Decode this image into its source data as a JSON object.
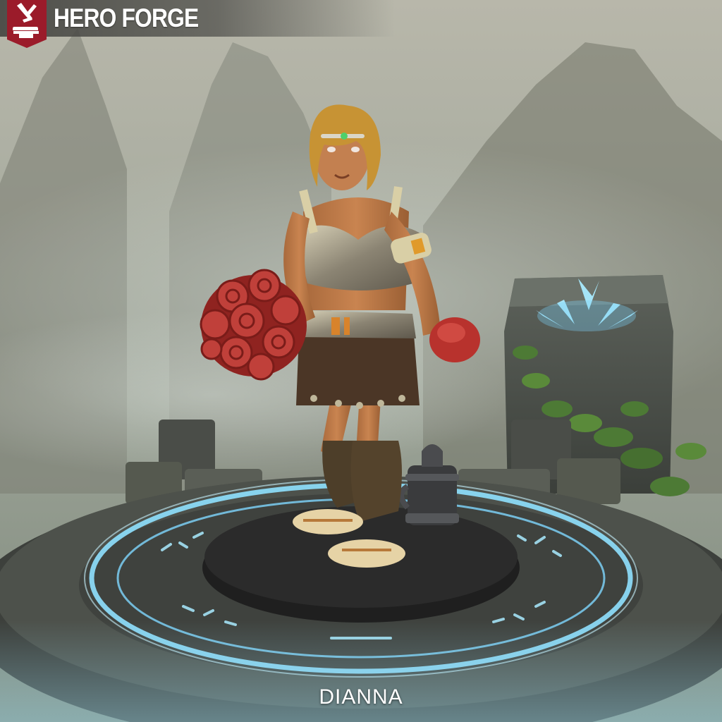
{
  "brand": {
    "title": "HERO FORGE",
    "logo_icon": "anvil-hammer-icon",
    "badge_color": "#9b1b2a"
  },
  "character": {
    "name": "DIANNA"
  },
  "scene": {
    "description_icons": [
      "runic-stone-icon",
      "tankard-icon",
      "rose-bouquet-icon"
    ],
    "rune_glow_color": "#7fd7ff"
  }
}
